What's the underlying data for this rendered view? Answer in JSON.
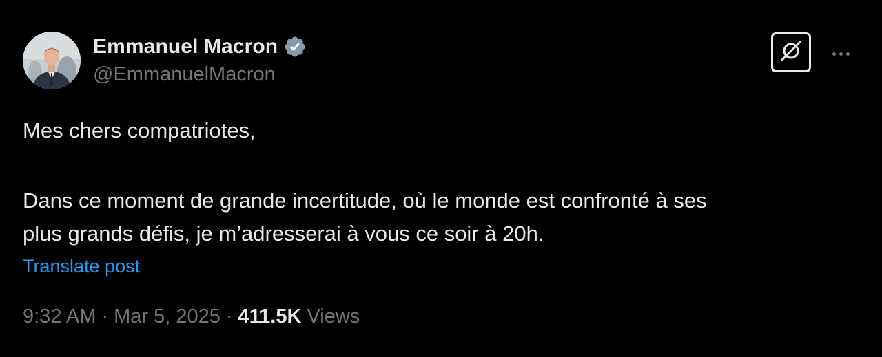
{
  "author": {
    "display_name": "Emmanuel Macron",
    "handle": "@EmmanuelMacron",
    "verified": true
  },
  "icons": {
    "verified": "verified-badge-icon",
    "grok": "grok-icon",
    "more": "more-options-icon"
  },
  "post": {
    "greeting": "Mes chers compatriotes,",
    "body_line_1": "Dans ce moment de grande incertitude, où le monde est confronté à ses",
    "body_line_2": "plus grands défis, je m’adresserai à vous ce soir à 20h.",
    "translate_label": "Translate post"
  },
  "meta": {
    "time": "9:32 AM",
    "separator": "·",
    "date": "Mar 5, 2025",
    "views_count": "411.5K",
    "views_label": "Views"
  },
  "colors": {
    "background": "#000000",
    "text_primary": "#e7e9ea",
    "text_secondary": "#71767b",
    "link": "#1d9bf0",
    "verified_badge": "#829aab"
  }
}
